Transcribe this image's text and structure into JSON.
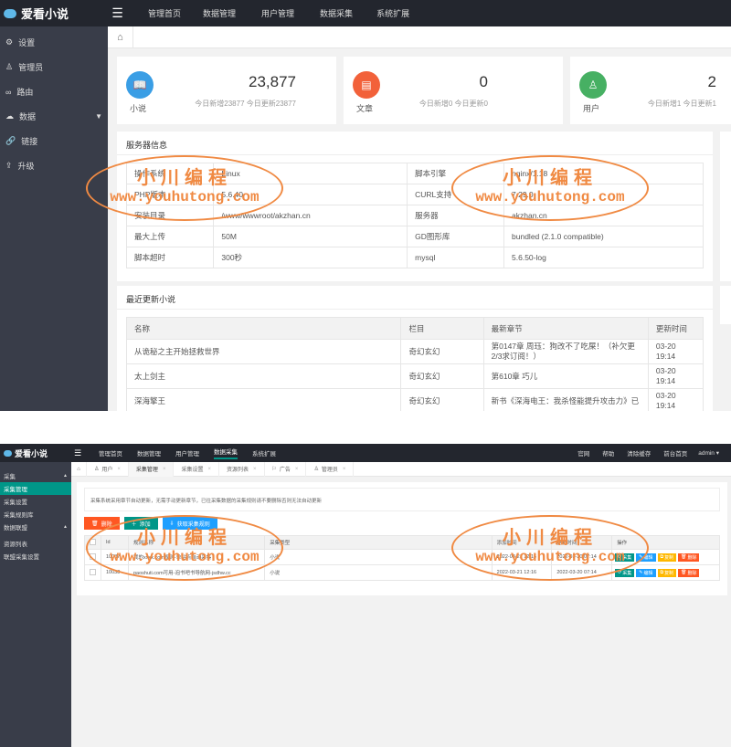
{
  "top": {
    "logo": "爱看小说",
    "nav": [
      "管理首页",
      "数据管理",
      "用户管理",
      "数据采集",
      "系统扩展"
    ]
  },
  "top_sidebar": [
    "设置",
    "管理员",
    "路由",
    "数据",
    "链接",
    "升级"
  ],
  "stats": [
    {
      "label": "小说",
      "value": "23,877",
      "sub": "今日新增23877 今日更新23877",
      "color": "#3a9ee5",
      "icon": "book-icon"
    },
    {
      "label": "文章",
      "value": "0",
      "sub": "今日新增0 今日更新0",
      "color": "#f2613a",
      "icon": "document-icon"
    },
    {
      "label": "用户",
      "value": "2",
      "sub": "今日新增1 今日更新1",
      "color": "#47b063",
      "icon": "user-icon"
    }
  ],
  "server": {
    "title": "服务器信息",
    "rows": [
      [
        "操作系统",
        "Linux",
        "脚本引擎",
        "nginx/1.18"
      ],
      [
        "PHP版本",
        "5.6.40",
        "CURL支持",
        "7.29.0"
      ],
      [
        "安装目录",
        "/www/wwwroot/akzhan.cn",
        "服务器",
        "akzhan.cn"
      ],
      [
        "最大上传",
        "50M",
        "GD图形库",
        "bundled (2.1.0 compatible)"
      ],
      [
        "脚本超时",
        "300秒",
        "mysql",
        "5.6.50-log"
      ]
    ]
  },
  "recent": {
    "title": "最近更新小说",
    "headers": [
      "名称",
      "栏目",
      "最新章节",
      "更新时间"
    ],
    "rows": [
      [
        "从诡秘之主开始拯救世界",
        "奇幻玄幻",
        "第0147章 周珏：狗改不了吃屎！（补欠更2/3求订阅！）",
        "03-20 19:14"
      ],
      [
        "太上剑主",
        "奇幻玄幻",
        "第610章 巧儿",
        "03-20 19:14"
      ],
      [
        "深海擎王",
        "奇幻玄幻",
        "新书《深海电王：我杀怪能提升攻击力》已",
        "03-20 19:14"
      ]
    ]
  },
  "bottom_top": {
    "logo": "爱看小说",
    "nav": [
      "管理首页",
      "数据管理",
      "用户管理",
      "数据采集",
      "系统扩展"
    ],
    "right": [
      "官网",
      "帮助",
      "清除缓存",
      "前台首页",
      "admin ▾"
    ]
  },
  "bottom_sidebar": {
    "groups": [
      {
        "title": "采集",
        "items": [
          "采集管理",
          "采集设置",
          "采集规则库"
        ]
      },
      {
        "title": "数据联盟",
        "items": [
          "资源列表",
          "联盟采集设置"
        ]
      }
    ]
  },
  "tabs": [
    "用户",
    "采集管理",
    "采集设置",
    "资源列表",
    "广告",
    "管理员"
  ],
  "notice": "采集系统采用章节自动更新，无需手动更新章节，已往采集数据的采集规则请不要删除否则无法自动更新",
  "buttons": {
    "delete": "删除",
    "add": "添加",
    "fetch": "获取采集规则"
  },
  "collect_table": {
    "headers": [
      "",
      "Id",
      "规则名称",
      "采集类型",
      "添加时间",
      "更新时间",
      "操作"
    ],
    "rows": [
      [
        "",
        "10037",
        "我的xxxx.com规则-单站点自动采集",
        "小说",
        "2022-03-21 12:16",
        "2022-03-20 07:14"
      ],
      [
        "",
        "10038",
        "paoshuti.com可用-泡书吧书导航网-jsdhw.cc",
        "小说",
        "2022-03-21 12:16",
        "2022-03-20 07:14"
      ]
    ],
    "actions": [
      "采集",
      "编辑",
      "复制",
      "删除"
    ]
  },
  "watermark": {
    "cn": "小川编程",
    "url": "www.youhutong.com"
  }
}
